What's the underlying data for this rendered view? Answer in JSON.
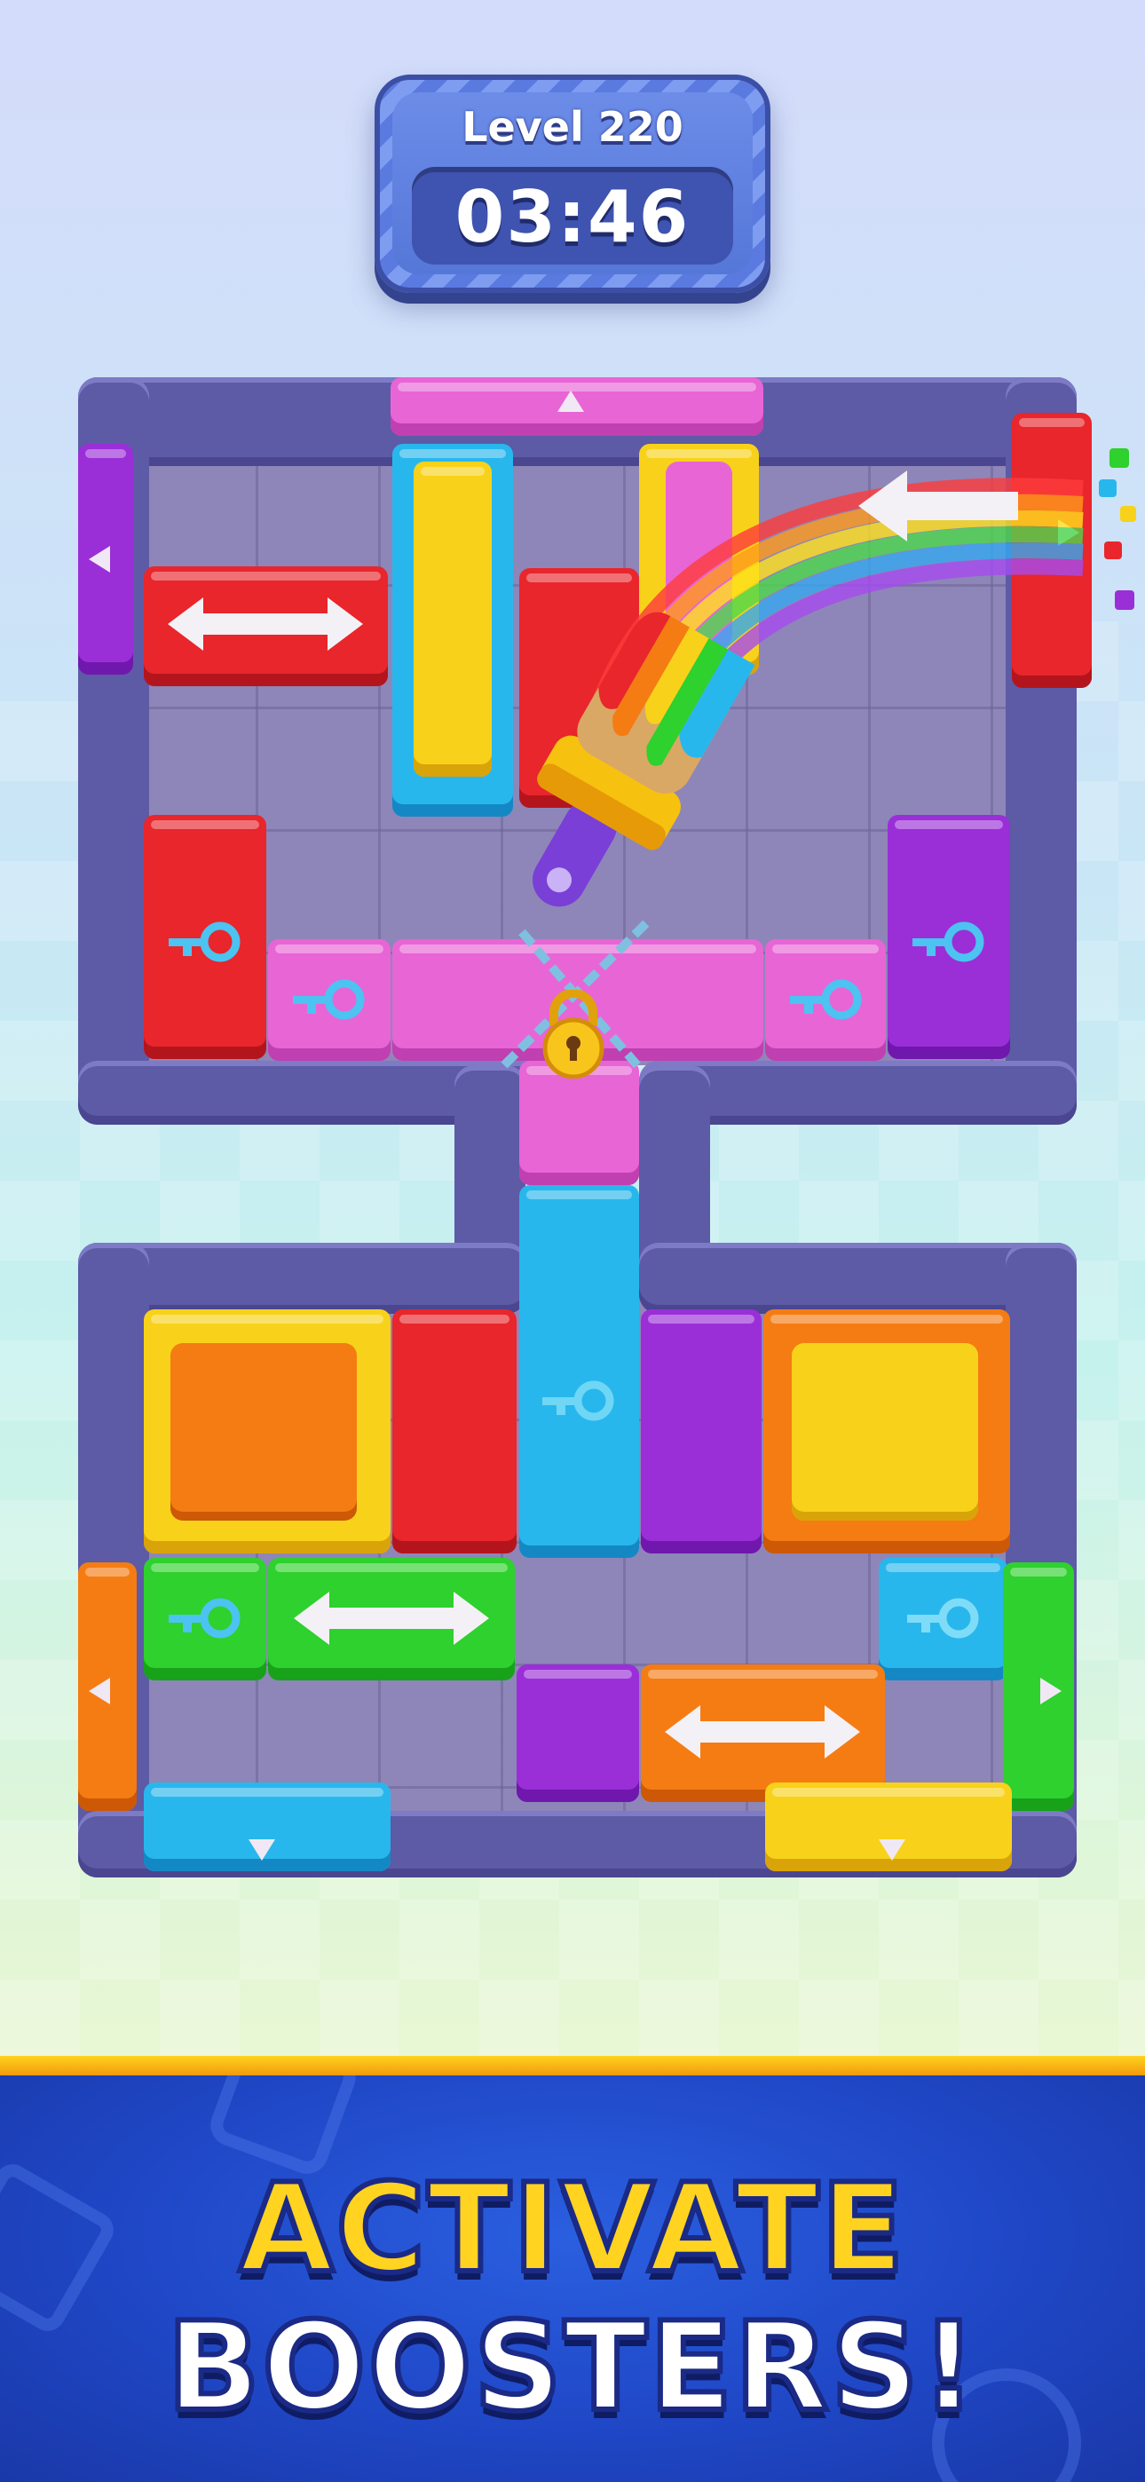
{
  "hud": {
    "level_label": "Level 220",
    "timer": "03:46"
  },
  "banner": {
    "line1": "ACTIVATE",
    "line2": "BOOSTERS!"
  },
  "colors": {
    "red": "#e8262c",
    "yellow": "#f8d21a",
    "blue": "#28b7ec",
    "pink": "#e865d6",
    "purple": "#9a2fd8",
    "orange": "#f57c13",
    "green": "#2ed12d",
    "frame": "#5d5aa6",
    "banner": "#1f47c6"
  },
  "booster": {
    "icon": "paintbrush-icon",
    "effect": "rainbow"
  },
  "lock": {
    "icon": "padlock-icon"
  }
}
